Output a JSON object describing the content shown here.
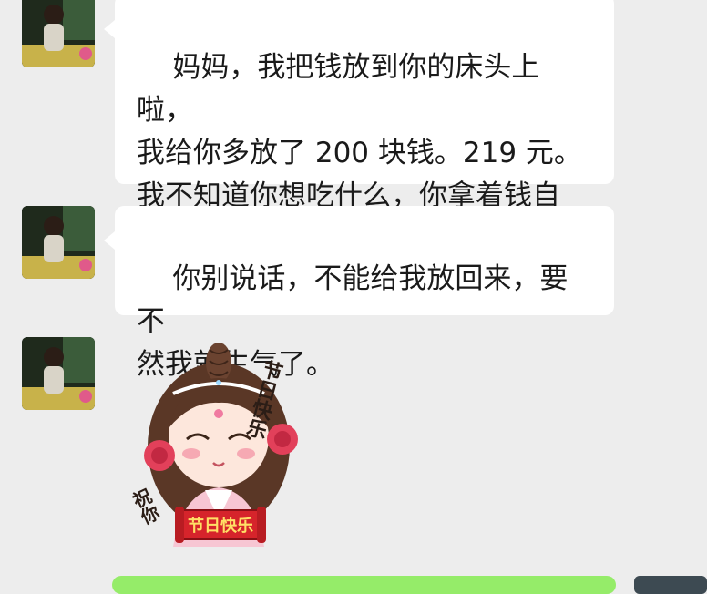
{
  "chat": {
    "messages": [
      {
        "sender": "other",
        "text": "妈妈，我把钱放到你的床头上啦，\n我给你多放了 200 块钱。219 元。\n我不知道你想吃什么，你拿着钱自\n己买。"
      },
      {
        "sender": "other",
        "text": "你别说话，不能给我放回来，要不\n然我就生气了。"
      },
      {
        "sender": "other",
        "sticker": {
          "icon": "festival-girl-sticker",
          "side_text_top": "节日快乐",
          "side_text_left": "祝你",
          "banner_text": "节日快乐"
        }
      }
    ]
  },
  "colors": {
    "background": "#ededed",
    "bubble_received": "#ffffff",
    "bubble_sent": "#95ec69",
    "sticker_banner": "#d6242b",
    "sticker_banner_text": "#ffe066"
  }
}
